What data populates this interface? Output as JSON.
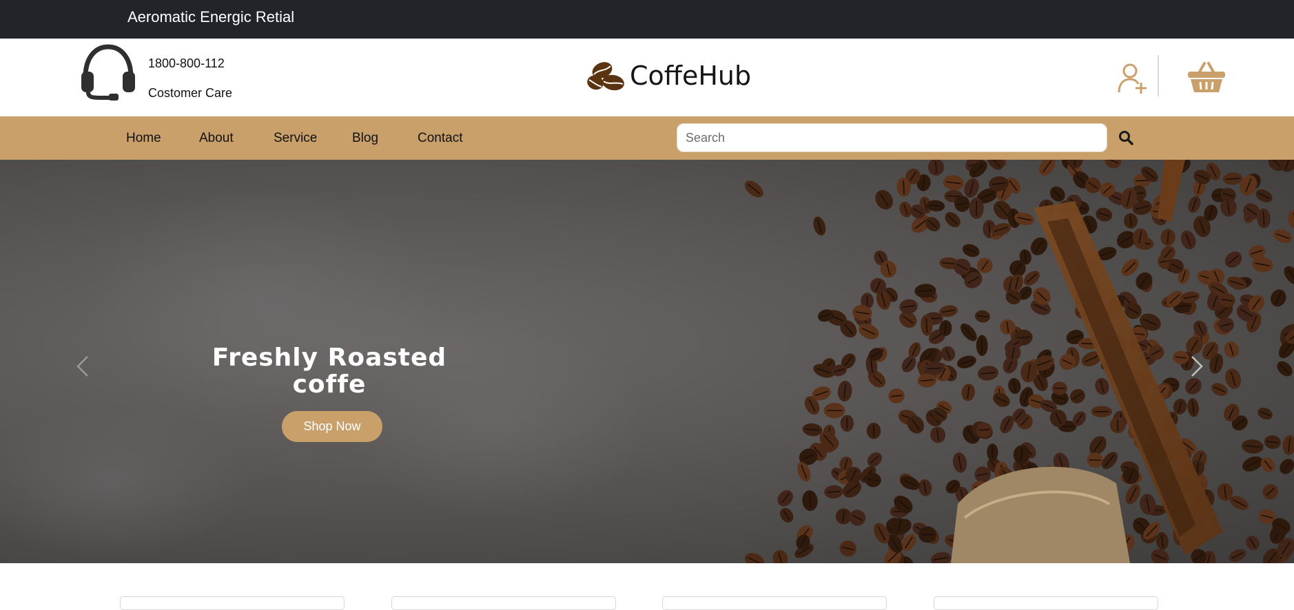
{
  "topbar": {
    "tagline": "Aeromatic Energic Retial"
  },
  "header": {
    "phone": "1800-800-112",
    "care_label": "Costomer Care",
    "brand_name": "CoffeHub",
    "icons": {
      "support": "headset-icon",
      "brand": "coffee-bean-icon",
      "user": "user-add-icon",
      "cart": "basket-icon"
    }
  },
  "nav": {
    "items": [
      "Home",
      "About",
      "Service",
      "Blog",
      "Contact"
    ],
    "search_placeholder": "Search"
  },
  "hero": {
    "title": "Freshly Roasted coffe",
    "cta": "Shop Now"
  },
  "colors": {
    "accent": "#c9a06a",
    "topbar": "#212529",
    "brand_bean": "#5a3410"
  }
}
